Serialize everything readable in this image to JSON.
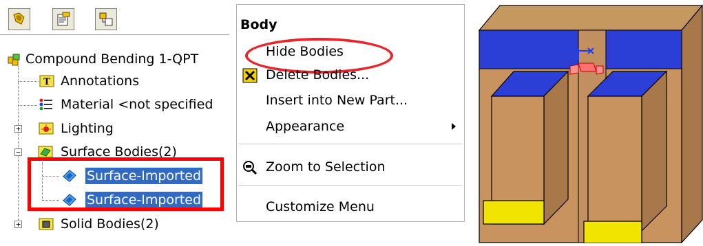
{
  "tree": {
    "root_label": "Compound Bending 1-QPT",
    "items": [
      {
        "label": "Annotations"
      },
      {
        "label": "Material <not specified"
      },
      {
        "label": "Lighting"
      },
      {
        "label": "Surface Bodies(2)"
      },
      {
        "label": "Surface-Imported"
      },
      {
        "label": "Surface-Imported"
      },
      {
        "label": "Solid Bodies(2)"
      }
    ],
    "expander_plus": "+",
    "expander_minus": "−"
  },
  "menu": {
    "title": "Body",
    "items": [
      {
        "label": "Hide Bodies"
      },
      {
        "label": "Delete Bodies..."
      },
      {
        "label": "Insert into New Part..."
      },
      {
        "label": "Appearance"
      },
      {
        "label": "Zoom to Selection"
      },
      {
        "label": "Customize Menu"
      }
    ]
  },
  "colors": {
    "highlight_red": "#ff0000",
    "selection_blue": "#316ac5",
    "model_tan": "#c8935e",
    "model_blue": "#2b3fd6",
    "model_yellow": "#f0e400"
  }
}
